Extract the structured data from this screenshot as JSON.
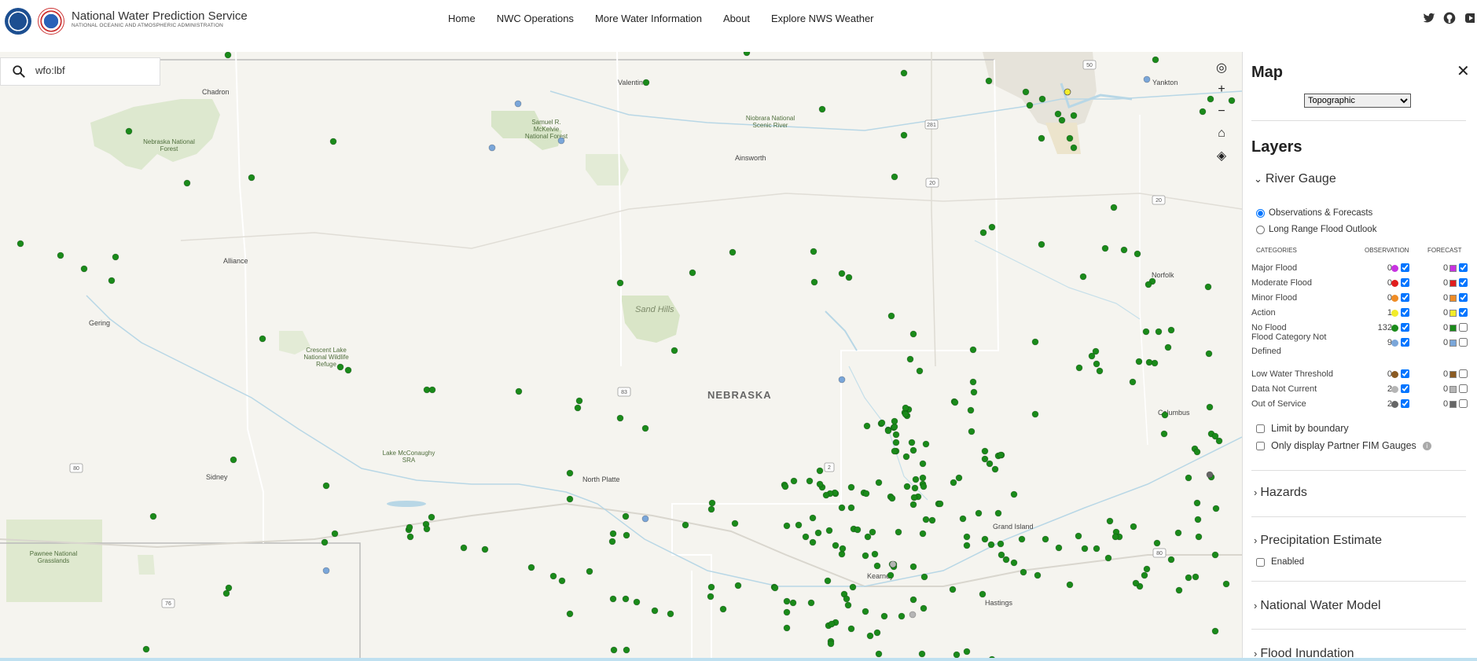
{
  "header": {
    "title": "National Water Prediction Service",
    "subtitle": "NATIONAL OCEANIC AND ATMOSPHERIC ADMINISTRATION",
    "nav": [
      "Home",
      "NWC Operations",
      "More Water Information",
      "About",
      "Explore NWS Weather"
    ],
    "social": [
      "twitter-icon",
      "github-icon",
      "youtube-icon"
    ]
  },
  "search": {
    "value": "wfo:lbf"
  },
  "map": {
    "labels": {
      "chadron": "Chadron",
      "valentine": "Valentine",
      "yankton": "Yankton",
      "nebraska_nf": "Nebraska National Forest",
      "samuel": "Samuel R. McKelvie National Forest",
      "niobrara": "Niobrara National Scenic River",
      "ainsworth": "Ainsworth",
      "alliance": "Alliance",
      "norfolk": "Norfolk",
      "gering": "Gering",
      "sandhills": "Sand Hills",
      "crescent": "Crescent Lake National Wildlife Refuge",
      "nebraska": "NEBRASKA",
      "columbus": "Columbus",
      "mcconaughy": "Lake McConaughy SRA",
      "sidney": "Sidney",
      "north_platte": "North Platte",
      "grand_island": "Grand Island",
      "pawnee": "Pawnee National Grasslands",
      "kearney": "Kearney",
      "hastings": "Hastings"
    },
    "shields": [
      "281",
      "50",
      "20",
      "20",
      "83",
      "2",
      "80",
      "80",
      "76"
    ],
    "tools": [
      "locate-icon",
      "zoom-in-icon",
      "zoom-out-icon",
      "home-icon",
      "layers-icon"
    ],
    "tool_glyphs": [
      "◎",
      "+",
      "−",
      "⌂",
      "◈"
    ]
  },
  "panel": {
    "title": "Map",
    "basemap": "Topographic",
    "layers_title": "Layers",
    "river_gauge": "River Gauge",
    "radios": [
      "Observations & Forecasts",
      "Long Range Flood Outlook"
    ],
    "headers": {
      "categories": "CATEGORIES",
      "observation": "OBSERVATION",
      "forecast": "FORECAST"
    },
    "categories": [
      {
        "name": "Major Flood",
        "obs": "0",
        "fc": "0",
        "color": "#c733e0",
        "obs_checked": true,
        "fc_checked": true
      },
      {
        "name": "Moderate Flood",
        "obs": "0",
        "fc": "0",
        "color": "#e01e1e",
        "obs_checked": true,
        "fc_checked": true
      },
      {
        "name": "Minor Flood",
        "obs": "0",
        "fc": "0",
        "color": "#ef8c26",
        "obs_checked": true,
        "fc_checked": true
      },
      {
        "name": "Action",
        "obs": "1",
        "fc": "0",
        "color": "#f2ec2a",
        "obs_checked": true,
        "fc_checked": true
      },
      {
        "name": "No Flood",
        "obs": "132",
        "fc": "0",
        "color": "#1a8a1a",
        "obs_checked": true,
        "fc_checked": false
      },
      {
        "name": "Flood Category Not Defined",
        "obs": "9",
        "fc": "0",
        "color": "#7aa6d9",
        "obs_checked": true,
        "fc_checked": false
      },
      {
        "name": "Low Water Threshold",
        "obs": "0",
        "fc": "0",
        "color": "#8a5a22",
        "obs_checked": true,
        "fc_checked": false
      },
      {
        "name": "Data Not Current",
        "obs": "2",
        "fc": "0",
        "color": "#b5b5b5",
        "obs_checked": true,
        "fc_checked": false
      },
      {
        "name": "Out of Service",
        "obs": "2",
        "fc": "0",
        "color": "#666666",
        "obs_checked": true,
        "fc_checked": false
      }
    ],
    "limit_boundary": "Limit by boundary",
    "partner_fim": "Only display Partner FIM Gauges",
    "hazards": "Hazards",
    "precip": "Precipitation Estimate",
    "enabled": "Enabled",
    "nwm": "National Water Model",
    "partial": "Flood Inundation"
  }
}
